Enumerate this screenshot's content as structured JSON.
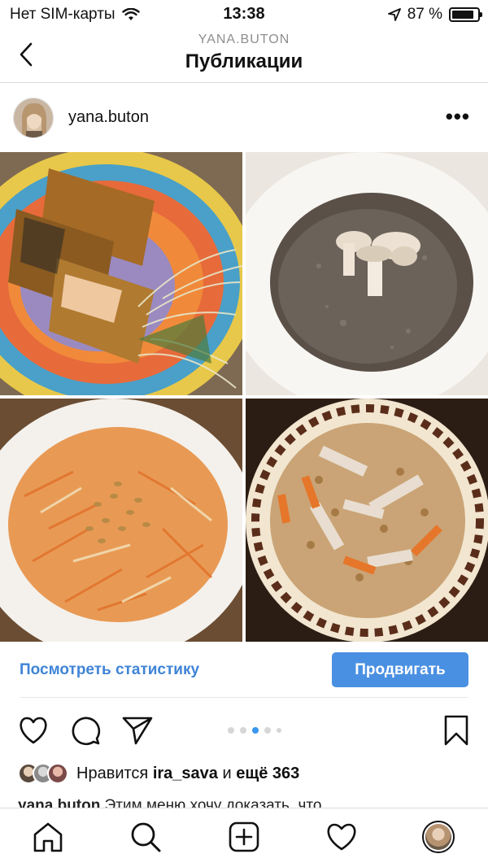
{
  "status": {
    "carrier": "Нет SIM-карты",
    "time": "13:38",
    "battery_text": "87 %",
    "battery_level": 0.87
  },
  "nav": {
    "subtitle": "YANA.BUTON",
    "title": "Публикации"
  },
  "post": {
    "username": "yana.buton",
    "stats_link": "Посмотреть статистику",
    "promote_button": "Продвигать",
    "carousel_total": 5,
    "carousel_active": 3,
    "likes_prefix": "Нравится",
    "likes_user": "ira_sava",
    "likes_middle": "и",
    "likes_count_text": "ещё 363",
    "caption_user": "yana.buton",
    "caption_text": "Этим меню хочу доказать, что"
  },
  "icons": {
    "back": "chevron-left-icon",
    "more": "more-dots-icon",
    "like": "heart-icon",
    "comment": "comment-icon",
    "share": "send-icon",
    "save": "bookmark-icon",
    "tabs": [
      "home-icon",
      "search-icon",
      "add-post-icon",
      "activity-heart-icon",
      "profile-avatar"
    ]
  },
  "colors": {
    "accent": "#3897f0",
    "link": "#3f84d6",
    "promote_bg": "#4a90e2"
  }
}
